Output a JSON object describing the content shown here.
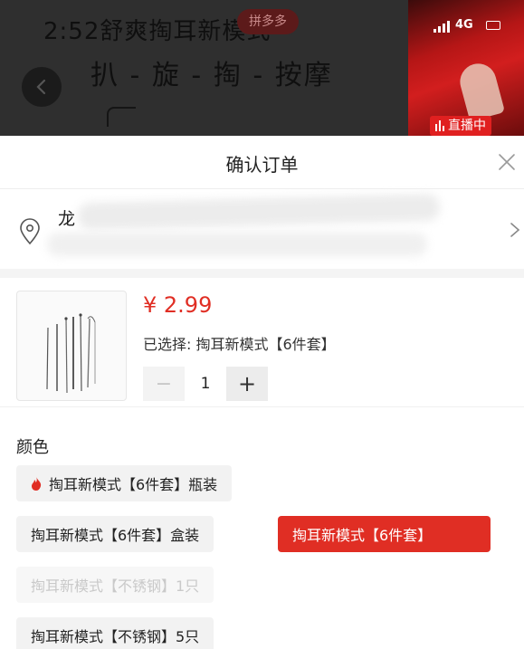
{
  "video": {
    "banner_line1": "2:52舒爽掏耳新模式",
    "banner_line2": "扒 - 旋 - 掏 - 按摩",
    "logo_text": "拼多多"
  },
  "live_preview": {
    "network": "4G",
    "badge": "直播中"
  },
  "sheet": {
    "title": "确认订单",
    "address": {
      "name": "龙"
    },
    "product": {
      "price": "¥ 2.99",
      "selected": "已选择: 掏耳新模式【6件套】",
      "quantity": "1",
      "minus_label": "−",
      "plus_label": "+"
    },
    "color": {
      "label": "颜色",
      "options": [
        {
          "label": "掏耳新模式【6件套】瓶装",
          "state": "normal",
          "icon": "flame-icon"
        },
        {
          "label": "掏耳新模式【6件套】盒装",
          "state": "normal"
        },
        {
          "label": "掏耳新模式【6件套】",
          "state": "selected"
        },
        {
          "label": "掏耳新模式【不锈钢】1只",
          "state": "disabled"
        },
        {
          "label": "掏耳新模式【不锈钢】5只",
          "state": "normal"
        }
      ]
    }
  },
  "colors": {
    "accent": "#e02e24",
    "live_red": "#e02020"
  }
}
